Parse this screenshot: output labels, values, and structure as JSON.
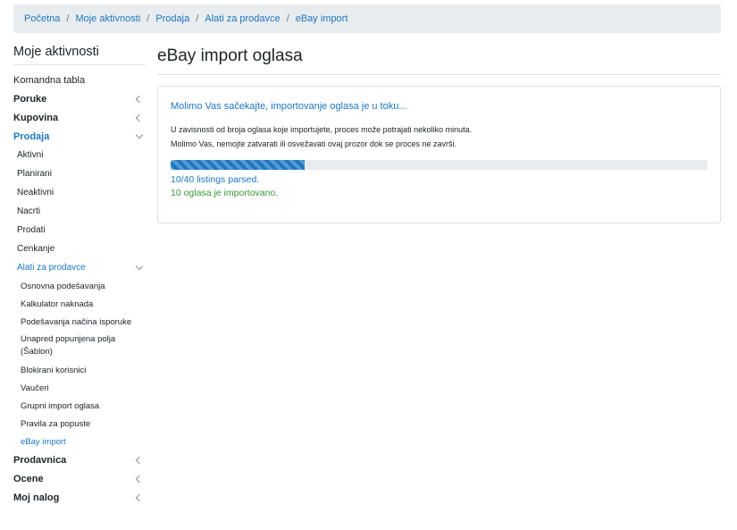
{
  "breadcrumb": [
    "Početna",
    "Moje aktivnosti",
    "Prodaja",
    "Alati za prodavce",
    "eBay import"
  ],
  "breadcrumb_separator": "/",
  "sidebar": {
    "title": "Moje aktivnosti",
    "items": [
      {
        "label": "Komandna tabla",
        "level": 0,
        "bold": false,
        "chevron": "none",
        "active": false
      },
      {
        "label": "Poruke",
        "level": 0,
        "bold": true,
        "chevron": "left",
        "active": false
      },
      {
        "label": "Kupovina",
        "level": 0,
        "bold": true,
        "chevron": "left",
        "active": false
      },
      {
        "label": "Prodaja",
        "level": 0,
        "bold": true,
        "chevron": "down",
        "active": true
      },
      {
        "label": "Aktivni",
        "level": 1,
        "bold": false,
        "chevron": "none",
        "active": false
      },
      {
        "label": "Planirani",
        "level": 1,
        "bold": false,
        "chevron": "none",
        "active": false
      },
      {
        "label": "Neaktivni",
        "level": 1,
        "bold": false,
        "chevron": "none",
        "active": false
      },
      {
        "label": "Nacrti",
        "level": 1,
        "bold": false,
        "chevron": "none",
        "active": false
      },
      {
        "label": "Prodati",
        "level": 1,
        "bold": false,
        "chevron": "none",
        "active": false
      },
      {
        "label": "Cenkanje",
        "level": 1,
        "bold": false,
        "chevron": "none",
        "active": false
      },
      {
        "label": "Alati za prodavce",
        "level": 1,
        "bold": false,
        "chevron": "down",
        "active": true
      },
      {
        "label": "Osnovna podešavanja",
        "level": 2,
        "bold": false,
        "chevron": "none",
        "active": false
      },
      {
        "label": "Kalkulator naknada",
        "level": 2,
        "bold": false,
        "chevron": "none",
        "active": false
      },
      {
        "label": "Podešavanja načina isporuke",
        "level": 2,
        "bold": false,
        "chevron": "none",
        "active": false
      },
      {
        "label": "Unapred popunjena polja (Šablon)",
        "level": 2,
        "bold": false,
        "chevron": "none",
        "active": false,
        "multiline": true
      },
      {
        "label": "Blokirani korisnici",
        "level": 2,
        "bold": false,
        "chevron": "none",
        "active": false
      },
      {
        "label": "Vaučeri",
        "level": 2,
        "bold": false,
        "chevron": "none",
        "active": false
      },
      {
        "label": "Grupni import oglasa",
        "level": 2,
        "bold": false,
        "chevron": "none",
        "active": false
      },
      {
        "label": "Pravila za popuste",
        "level": 2,
        "bold": false,
        "chevron": "none",
        "active": false
      },
      {
        "label": "eBay import",
        "level": 2,
        "bold": false,
        "chevron": "none",
        "active": true
      },
      {
        "label": "Prodavnica",
        "level": 0,
        "bold": true,
        "chevron": "left",
        "active": false
      },
      {
        "label": "Ocene",
        "level": 0,
        "bold": true,
        "chevron": "left",
        "active": false
      },
      {
        "label": "Moj nalog",
        "level": 0,
        "bold": true,
        "chevron": "left",
        "active": false
      }
    ]
  },
  "main": {
    "title": "eBay import oglasa",
    "status_heading": "Molimo Vas sačekajte, importovanje oglasa je u toku...",
    "info_line1": "U zavisnosti od broja oglasa koje importujete, proces može potrajati nekoliko minuta.",
    "info_line2": "Molimo Vas, nemojte zatvarati ili osvežavati ovaj prozor dok se proces ne završi.",
    "progress_fraction": 0.25,
    "parsed_text": "10/40 listings parsed.",
    "imported_text": "10 oglasa je importovano."
  },
  "colors": {
    "accent": "#1d77c2",
    "success": "#3a9a3a",
    "breadcrumb_bg": "#e9ecef",
    "progress_track": "#e9ecef"
  }
}
